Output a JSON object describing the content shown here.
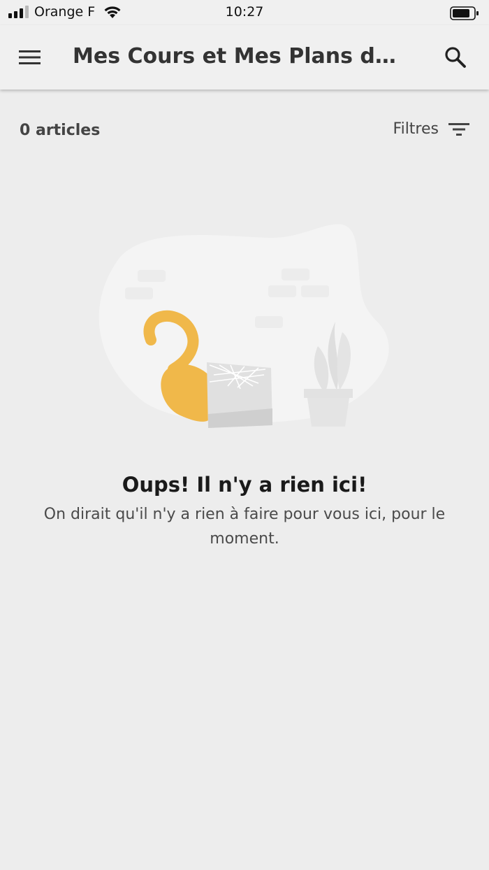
{
  "status_bar": {
    "carrier": "Orange F",
    "time": "10:27"
  },
  "app_bar": {
    "title": "Mes Cours et Mes Plans de Formation"
  },
  "toolbar": {
    "count_label": "0 articles",
    "filters_label": "Filtres"
  },
  "empty_state": {
    "title": "Oups! Il n'y a rien ici!",
    "message": "On dirait qu'il n'y a rien à faire pour vous ici, pour le moment."
  },
  "colors": {
    "accent": "#f0b84a",
    "background": "#ededed",
    "app_bar": "#f0f0f0"
  },
  "icons": {
    "menu": "hamburger-menu-icon",
    "search": "search-icon",
    "filters": "filter-lines-icon",
    "wifi": "wifi-icon",
    "battery": "battery-icon",
    "signal": "cellular-signal-icon"
  }
}
